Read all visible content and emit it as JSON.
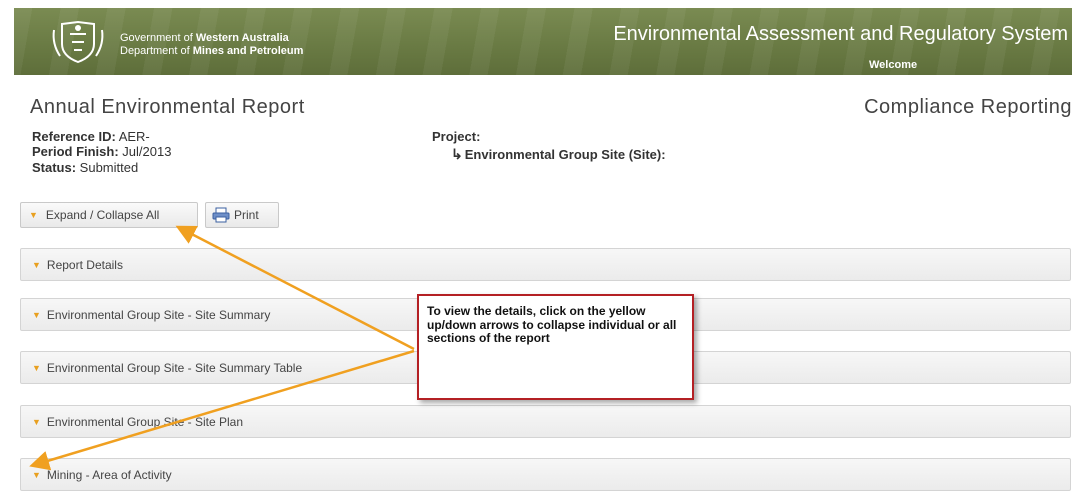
{
  "header": {
    "gov_line1_prefix": "Government of ",
    "gov_line1_bold": "Western Australia",
    "gov_line2_prefix": "Department of ",
    "gov_line2_bold": "Mines and Petroleum",
    "system_title": "Environmental Assessment and Regulatory System",
    "welcome": "Welcome"
  },
  "page": {
    "title": "Annual Environmental Report",
    "section": "Compliance Reporting"
  },
  "meta": {
    "reference_label": "Reference ID:",
    "reference_value": " AER-",
    "period_label": "Period Finish:",
    "period_value": " Jul/2013",
    "status_label": "Status:",
    "status_value": " Submitted",
    "project_label": "Project:",
    "project_site": "Environmental Group Site (Site):"
  },
  "toolbar": {
    "expand_label": "Expand / Collapse All",
    "print_label": "Print"
  },
  "sections": [
    {
      "label": "Report Details"
    },
    {
      "label": "Environmental Group Site - Site Summary"
    },
    {
      "label": "Environmental Group Site - Site Summary Table"
    },
    {
      "label": "Environmental Group Site - Site Plan"
    },
    {
      "label": "Mining - Area of Activity"
    }
  ],
  "callout": {
    "text": "To view the details, click on the yellow up/down arrows to collapse individual or all sections of the report"
  },
  "colors": {
    "banner": "#6a7b44",
    "caret": "#e8a020",
    "callout_border": "#b42024",
    "annotation_arrow": "#f0a020"
  },
  "icons": {
    "crest": "wa-crest-icon",
    "caret": "caret-down-icon",
    "print": "printer-icon",
    "project_arrow": "turn-right-arrow-icon"
  }
}
